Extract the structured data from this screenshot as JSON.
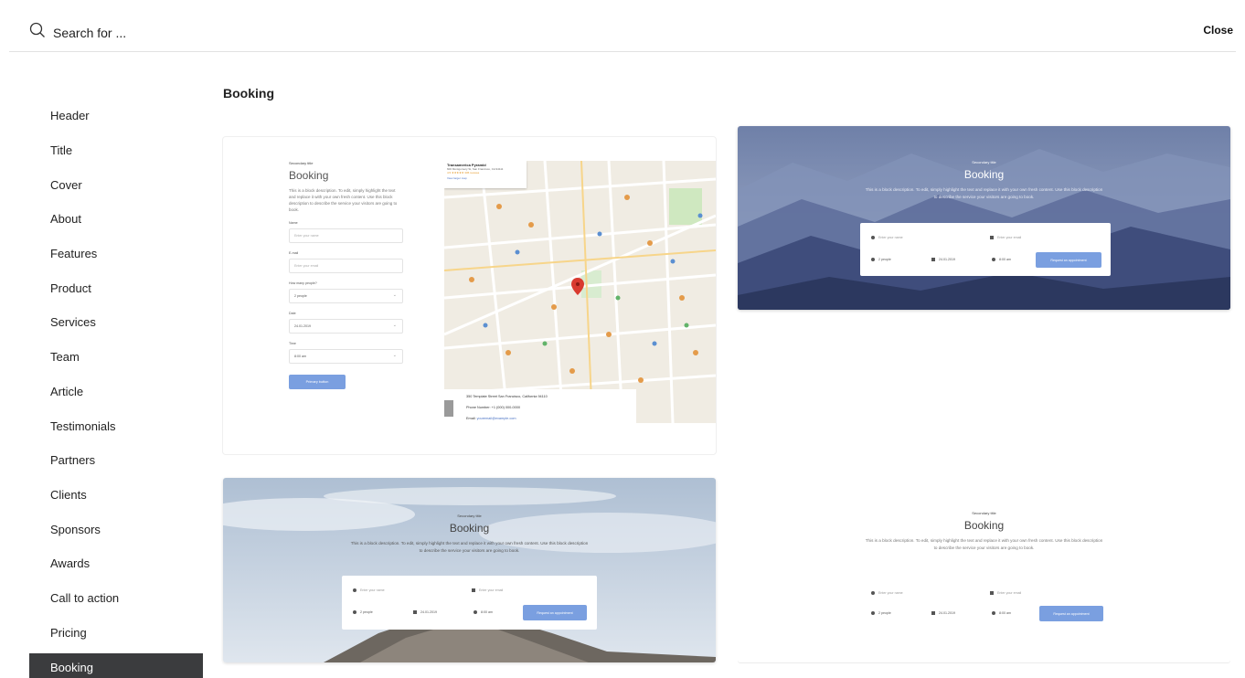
{
  "search": {
    "placeholder": "Search for ..."
  },
  "close_label": "Close",
  "sidebar": {
    "items": [
      {
        "label": "Header"
      },
      {
        "label": "Title"
      },
      {
        "label": "Cover"
      },
      {
        "label": "About"
      },
      {
        "label": "Features"
      },
      {
        "label": "Product"
      },
      {
        "label": "Services"
      },
      {
        "label": "Team"
      },
      {
        "label": "Article"
      },
      {
        "label": "Testimonials"
      },
      {
        "label": "Partners"
      },
      {
        "label": "Clients"
      },
      {
        "label": "Sponsors"
      },
      {
        "label": "Awards"
      },
      {
        "label": "Call to action"
      },
      {
        "label": "Pricing"
      },
      {
        "label": "Booking"
      }
    ],
    "active": "Booking"
  },
  "section_title": "Booking",
  "colors": {
    "accent_button": "#7a9fe0",
    "active_item": "#3b3c3e"
  },
  "templates": {
    "common": {
      "secondary_title": "Secondary title",
      "title": "Booking",
      "description_wide": "This is a block description. To edit, simply highlight the text and replace it with your own fresh content. Use this block description to describe the service your visitors are going to book.",
      "name_placeholder": "Enter your name",
      "email_placeholder": "Enter your email",
      "people": "2 people",
      "date": "24.01.2019",
      "time": "8:00 am",
      "request_button": "Request an appointment"
    },
    "map_card": {
      "description": "This is a block description. To edit, simply highlight the text and replace it with your own fresh content. Use this block description to describe the service your visitors are going to book.",
      "labels": {
        "name": "Name",
        "email": "E-mail",
        "people": "How many people?",
        "date": "Date",
        "time": "Time"
      },
      "email_placeholder": "Enter your email",
      "primary_button": "Primary button",
      "map_place_name": "Transamerica Pyramid",
      "map_place_address": "600 Montgomery St, San Francisco, CA 94111",
      "map_rating": "4.5 ★★★★★ 305 reviews",
      "map_view_larger": "View larger map",
      "address_line": "350 Template Street San Francisco, California 94110",
      "phone_line": "Phone Number: +1 (000) 000-0000",
      "email_prefix": "Email: ",
      "email_link": "youremail@example.com"
    }
  }
}
